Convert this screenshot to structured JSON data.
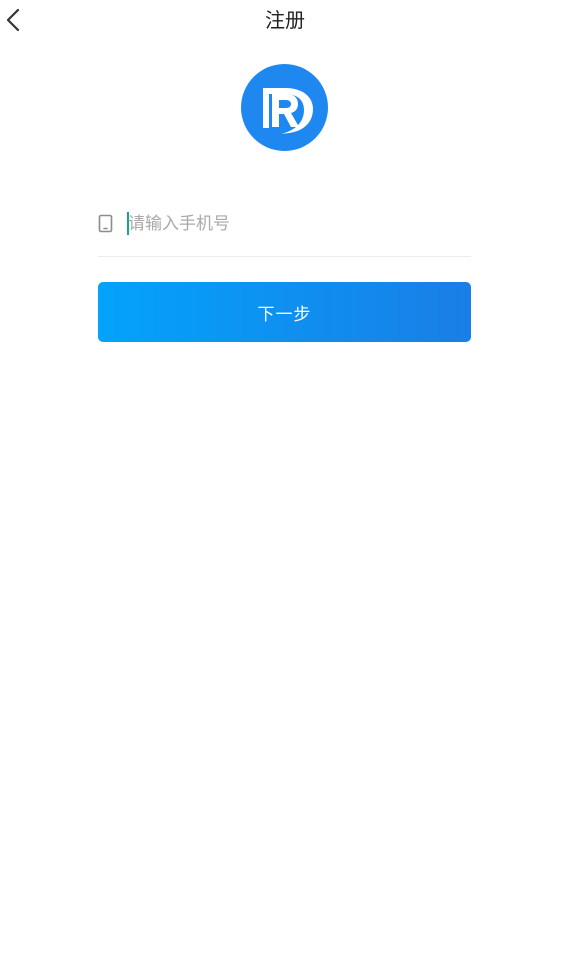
{
  "header": {
    "title": "注册",
    "back_icon": "chevron-left-icon"
  },
  "logo": {
    "icon": "brand-r-logo",
    "bg_color": "#1e88f0"
  },
  "form": {
    "phone": {
      "icon": "phone-icon",
      "value": "",
      "placeholder": "请输入手机号"
    },
    "next_button_label": "下一步"
  },
  "colors": {
    "accent_start": "#03a3fb",
    "accent_end": "#1a7ee6",
    "caret": "#17a589",
    "title_text": "#222222",
    "placeholder": "#a9a9a9"
  }
}
